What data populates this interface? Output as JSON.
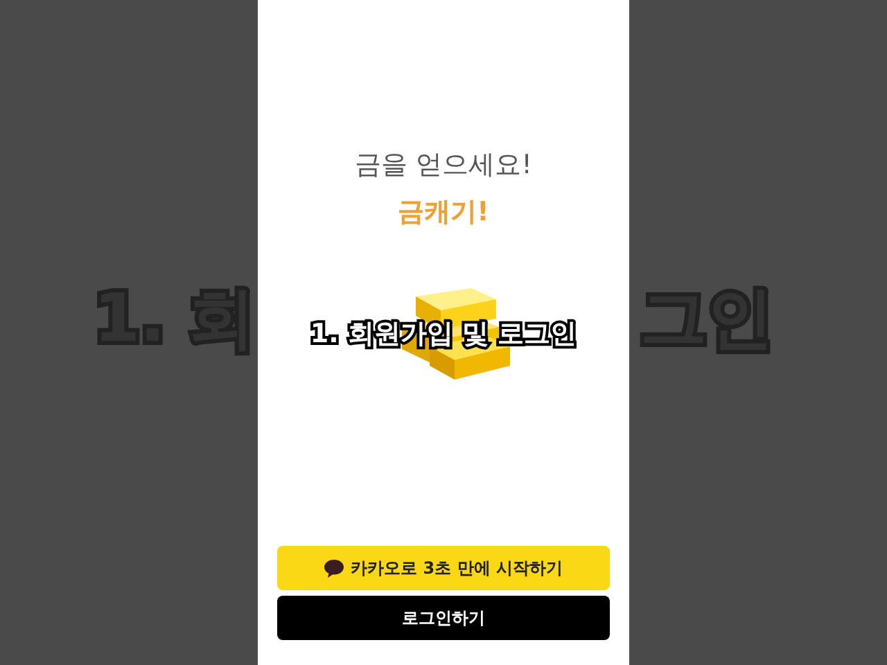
{
  "background_caption": {
    "left": "1. 회",
    "right": "그인"
  },
  "screen": {
    "headline": "금을 얻으세요!",
    "brand": "금캐기!",
    "caption": "1. 회원가입 및 로그인",
    "buttons": [
      {
        "kind": "kakao",
        "label": "카카오로 3초 만에 시작하기"
      },
      {
        "kind": "login",
        "label": "로그인하기"
      }
    ]
  }
}
